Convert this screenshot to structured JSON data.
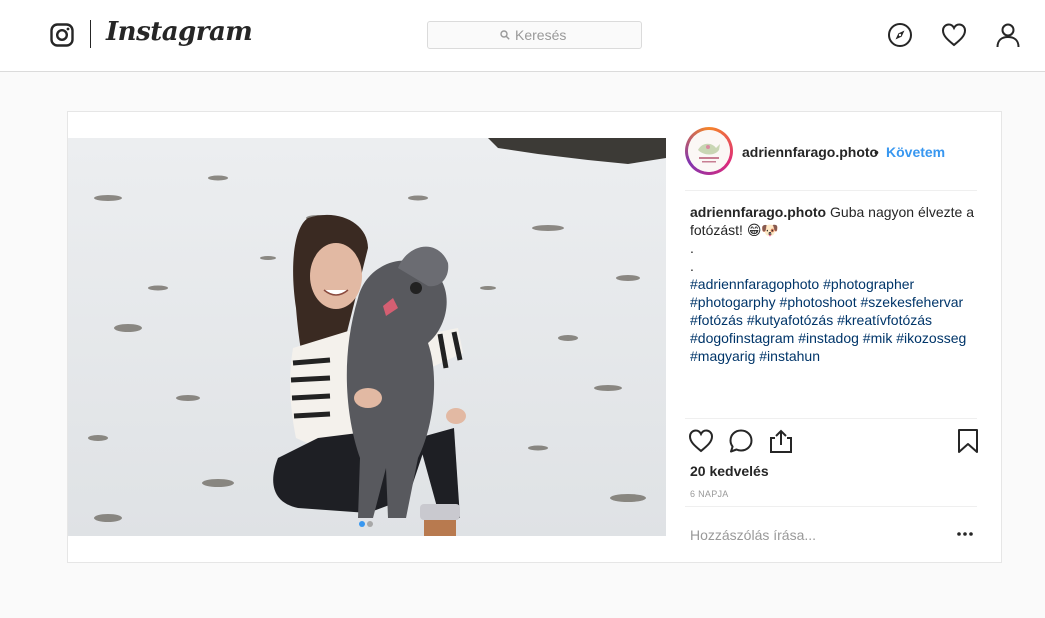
{
  "nav": {
    "logo_text": "Instagram",
    "search_placeholder": "Keresés",
    "icons": [
      "camera-icon",
      "search-icon",
      "compass-icon",
      "heart-icon",
      "user-icon"
    ]
  },
  "post": {
    "username": "adriennfarago.photo",
    "separator": "•",
    "follow_label": "Követem",
    "caption_username": "adriennfarago.photo",
    "caption_text": "Guba nagyon élvezte a fotózást!",
    "caption_emoji": "😁🐶",
    "caption_dot1": ".",
    "caption_dot2": ".",
    "hashtags": [
      "#adriennfaragophoto",
      "#photographer",
      "#photogarphy",
      "#photoshoot",
      "#szekesfehervar",
      "#fotózás",
      "#kutyafotózás",
      "#kreatívfotózás",
      "#dogofinstagram",
      "#instadog",
      "#mik",
      "#ikozosseg",
      "#magyarig",
      "#instahun"
    ],
    "likes": "20 kedvelés",
    "time": "6 NAPJA",
    "comment_placeholder": "Hozzászólás írása...",
    "carousel": {
      "slides": 2,
      "active": 1
    }
  },
  "colors": {
    "accent": "#3897f0",
    "hashtag": "#003569",
    "border": "#dbdbdb",
    "background": "#fafafa"
  }
}
